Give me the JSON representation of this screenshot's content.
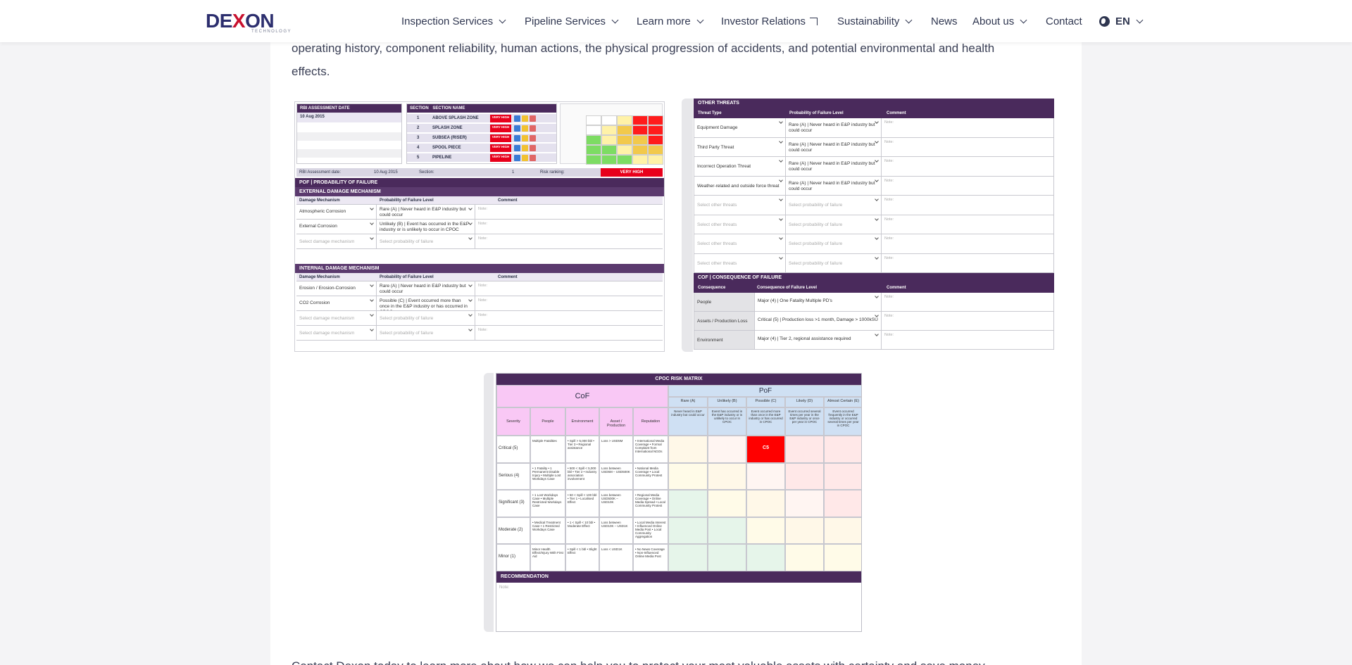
{
  "header": {
    "logo_text": "DEXON",
    "logo_subtext": "TECHNOLOGY",
    "nav": [
      {
        "label": "Inspection Services",
        "has_dropdown": true
      },
      {
        "label": "Pipeline Services",
        "has_dropdown": true
      },
      {
        "label": "Learn more",
        "has_dropdown": true
      },
      {
        "label": "Investor Relations",
        "external": true
      },
      {
        "label": "Sustainability",
        "has_dropdown": true
      },
      {
        "label": "News"
      },
      {
        "label": "About us",
        "has_dropdown": true
      },
      {
        "label": "Contact"
      }
    ],
    "language": "EN"
  },
  "content": {
    "intro_line1": "operating history, component reliability, human actions, the physical progression of accidents, and potential environmental and health",
    "intro_line2": "effects.",
    "cta": "Contact Dexon today to learn more about how we can help you to protect your most valuable assets with certainty and save money."
  },
  "shot1": {
    "assessment_date_label": "RBI ASSESSMENT DATE",
    "assessment_date": "10 Aug 2015",
    "section_label": "SECTION",
    "section_name_label": "SECTION NAME",
    "sections": [
      {
        "no": "1",
        "name": "ABOVE SPLASH ZONE"
      },
      {
        "no": "2",
        "name": "SPLASH ZONE"
      },
      {
        "no": "3",
        "name": "SUBSEA (RISER)"
      },
      {
        "no": "4",
        "name": "SPOOL PIECE"
      },
      {
        "no": "5",
        "name": "PIPELINE"
      }
    ],
    "risk_badge": "VERY HIGH",
    "bar_date_label": "RBI Assessment date:",
    "bar_date": "10 Aug 2015",
    "bar_section_label": "Section:",
    "bar_section": "1",
    "bar_risk_label": "Risk ranking:",
    "bar_risk": "VERY HIGH",
    "pof_title": "POF | PROBABILITY OF FAILURE",
    "external_title": "EXTERNAL DAMAGE MECHANISM",
    "internal_title": "INTERNAL DAMAGE MECHANISM",
    "col_mechanism": "Damage Mechanism",
    "col_probability": "Probability of Failure Level",
    "col_comment": "Comment",
    "external_rows": [
      {
        "mechanism": "Atmospheric Corrosion",
        "probability": "Rare (A) | Never heard in E&P industry but could occur"
      },
      {
        "mechanism": "External Corrosion",
        "probability": "Unlikely (B) | Event has occurred in the E&P industry or is unlikely to occur in CPOC"
      },
      {
        "mechanism": "Select damage mechanism",
        "probability": "Select probability of failure"
      }
    ],
    "internal_rows": [
      {
        "mechanism": "Erosion / Erosion-Corrosion",
        "probability": "Rare (A) | Never heard in E&P industry but could occur"
      },
      {
        "mechanism": "CO2 Corrosion",
        "probability": "Possible (C) | Event occurred more than once in the E&P industry or has occurred in CPOC"
      },
      {
        "mechanism": "Select damage mechanism",
        "probability": "Select probability of failure"
      },
      {
        "mechanism": "Select damage mechanism",
        "probability": "Select probability of failure"
      }
    ],
    "note_placeholder": "Note:"
  },
  "shot2": {
    "threats_title": "OTHER THREATS",
    "col_threat": "Threat Type",
    "col_probability": "Probability of Failure Level",
    "col_comment": "Comment",
    "threat_rows": [
      {
        "threat": "Equipment Damage",
        "probability": "Rare (A) | Never heard in E&P industry but could occur"
      },
      {
        "threat": "Third Party Threat",
        "probability": "Rare (A) | Never heard in E&P industry but could occur"
      },
      {
        "threat": "Incorrect Operation Threat",
        "probability": "Rare (A) | Never heard in E&P industry but could occur"
      },
      {
        "threat": "Weather-related and outside force threat",
        "probability": "Rare (A) | Never heard in E&P industry but could occur"
      },
      {
        "threat": "Select other threats",
        "probability": "Select probability of failure"
      },
      {
        "threat": "Select other threats",
        "probability": "Select probability of failure"
      },
      {
        "threat": "Select other threats",
        "probability": "Select probability of failure"
      },
      {
        "threat": "Select other threats",
        "probability": "Select probability of failure"
      }
    ],
    "cof_title": "COF | CONSEQUENCE OF FAILURE",
    "col_consequence": "Consequence",
    "col_level": "Consequence of Failure Level",
    "cof_rows": [
      {
        "consequence": "People",
        "level": "Major (4) | One Fatality Multiple PD's"
      },
      {
        "consequence": "Assets / Production Loss",
        "level": "Critical (5) | Production loss >1 month, Damage > 1000kSU"
      },
      {
        "consequence": "Environment",
        "level": "Major (4) | Tier 2, regional assistance required"
      }
    ],
    "note_placeholder": "Note:"
  },
  "shot3": {
    "title": "CPOC RISK MATRIX",
    "cof": "CoF",
    "pof": "PoF",
    "cof_cols": [
      "Severity",
      "People",
      "Environment",
      "Asset / Production",
      "Reputation"
    ],
    "pof_cols": [
      "Rare (A)",
      "Unlikely (B)",
      "Possible (C)",
      "Likely (D)",
      "Almost Certain (E)"
    ],
    "pof_desc": [
      "Never heard in E&P industry but could occur",
      "Event has occurred in the E&P industry or is unlikely to occur in CPOC",
      "Event occurred more than once in the E&P industry or has occurred in CPOC",
      "Event occurred several times per year in the E&P industry or once per year in CPOC",
      "Event occurred frequently in the E&P industry or occurred several times per year in CPOC"
    ],
    "rows": [
      {
        "severity": "Critical (5)",
        "people": "Multiple Fatalities",
        "env": "• Spill > 5,000 bbl • Tier 3 • Regional assistance",
        "asset": "Loss > USD5M",
        "rep": "• International Media Coverage • Formal Complaint from International NGOs"
      },
      {
        "severity": "Serious (4)",
        "people": "• 1 Fatality • 1 Permanent Disable Injury • Multiple Lost Workdays Case",
        "env": "• 500 < Spill < 5,000 bbl • Tier 2 • Industry association involvement",
        "asset": "Loss between USD5M – USD500K",
        "rep": "• National Media Coverage • Local Community Protest"
      },
      {
        "severity": "Significant (3)",
        "people": "• 1 Lost Workdays Case • Multiple Restricted Workdays Case",
        "env": "• 50 < Spill < 100 bbl • Tier 1 • Localised Effect",
        "asset": "Loss between USD500K – USD10K",
        "rep": "• Regional Media Coverage • Online Media Spread • Local Community Protest"
      },
      {
        "severity": "Moderate (2)",
        "people": "• Medical Treatment Case • 1 Restricted Workdays Case",
        "env": "• 1 < Spill < 10 bbl • Moderate Effect",
        "asset": "Loss between USD10K – USD1K",
        "rep": "• Local Media Interest • Influenced Online Media Post • Local Community Aggregation"
      },
      {
        "severity": "Minor (1)",
        "people": "Minor Health Effect/Injury With First Aid",
        "env": "• Spill < 1 bbl • Slight Effect",
        "asset": "Loss < USD1K",
        "rep": "• No News Coverage • Non-Influenced Online Media Post"
      }
    ],
    "marker": "C5",
    "recommendation_title": "RECOMMENDATION",
    "note_placeholder": "Note:"
  }
}
